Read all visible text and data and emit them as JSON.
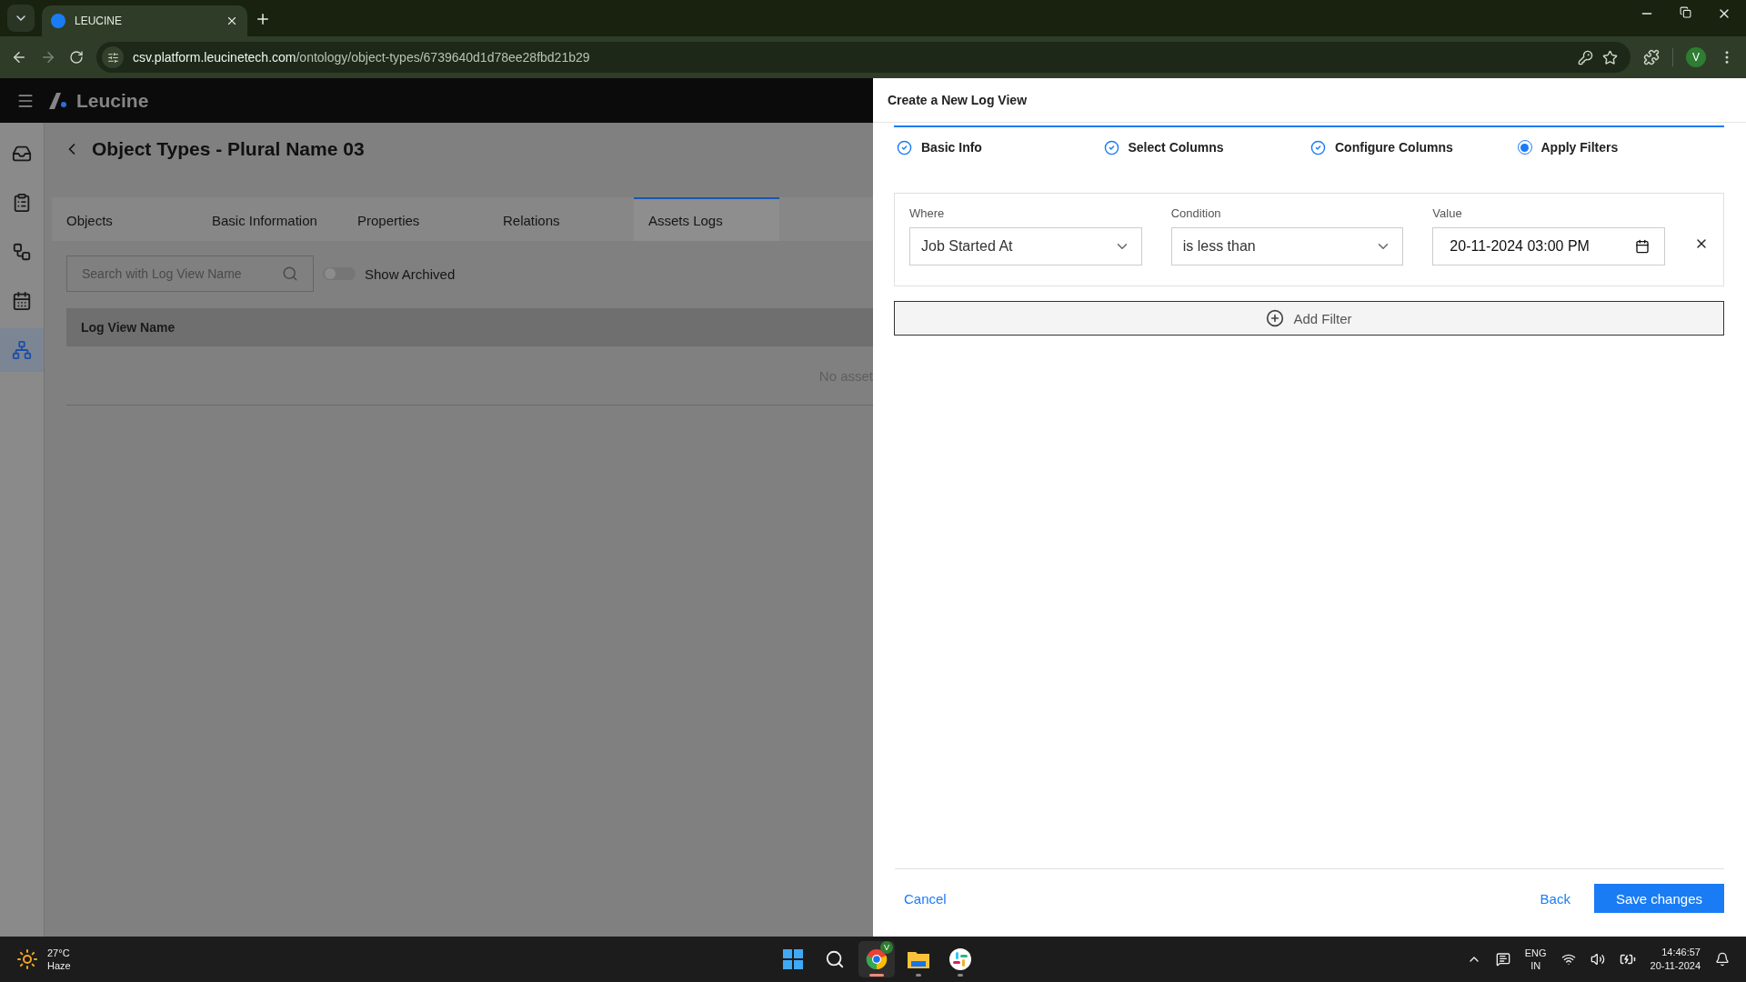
{
  "browser": {
    "tab_title": "LEUCINE",
    "url_host": "csv.platform.leucinetech.com",
    "url_path": "/ontology/object-types/6739640d1d78ee28fbd21b29",
    "profile": "V"
  },
  "app": {
    "brand": "Leucine",
    "sidebar": [
      {
        "kind": "inbox",
        "selected": false
      },
      {
        "kind": "checklist",
        "selected": false
      },
      {
        "kind": "flow",
        "selected": false
      },
      {
        "kind": "calendar",
        "selected": false
      },
      {
        "kind": "hierarchy",
        "selected": true
      }
    ],
    "page_title": "Object Types - Plural Name 03",
    "tabs": [
      {
        "label": "Objects",
        "selected": false
      },
      {
        "label": "Basic Information",
        "selected": false
      },
      {
        "label": "Properties",
        "selected": false
      },
      {
        "label": "Relations",
        "selected": false
      },
      {
        "label": "Assets Logs",
        "selected": true
      }
    ],
    "search": {
      "placeholder": "Search with Log View Name"
    },
    "archived_toggle": {
      "label": "Show Archived",
      "on": false
    },
    "table": {
      "columns": [
        "Log View Name"
      ],
      "empty_text": "No asset"
    }
  },
  "drawer": {
    "title": "Create a New Log View",
    "steps": [
      {
        "label": "Basic Info",
        "selected": false
      },
      {
        "label": "Select Columns",
        "selected": false
      },
      {
        "label": "Configure Columns",
        "selected": false
      },
      {
        "label": "Apply Filters",
        "selected": true
      }
    ],
    "filters": [
      {
        "where_label": "Where",
        "where": "Job Started At",
        "condition_label": "Condition",
        "condition": "is less than",
        "value_label": "Value",
        "value": "20-11-2024 03:00 PM"
      }
    ],
    "add_filter": "Add Filter",
    "footer": {
      "cancel": "Cancel",
      "back": "Back",
      "save": "Save changes"
    }
  },
  "taskbar": {
    "weather": {
      "temp": "27°C",
      "condition": "Haze"
    },
    "apps": [
      {
        "kind": "start",
        "active": false
      },
      {
        "kind": "search",
        "active": false
      },
      {
        "kind": "browser",
        "active": true,
        "badge": "V"
      },
      {
        "kind": "files",
        "active": false
      },
      {
        "kind": "chat",
        "active": false
      }
    ],
    "language": [
      "ENG",
      "IN"
    ],
    "time": "14:46:57",
    "date": "20-11-2024"
  }
}
